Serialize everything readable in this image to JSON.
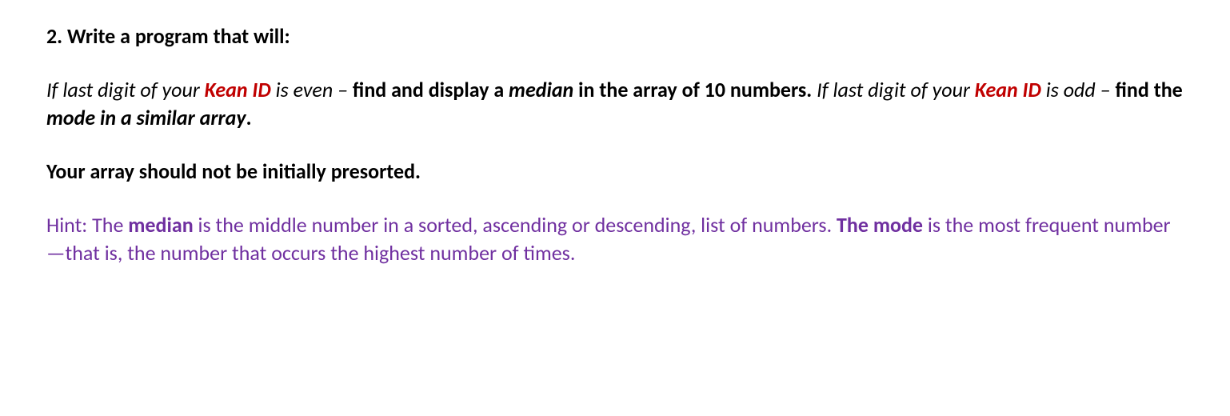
{
  "heading": "2. Write a program that will:",
  "p1": {
    "s1_pre": "If last digit of your ",
    "s1_kean": "Kean ID",
    "s1_mid": " is even – ",
    "s1_bold1": "find and display a ",
    "s1_median": "median",
    "s1_bold2": " in the array of 10 numbers. ",
    "s2_pre": "If last digit of your ",
    "s2_kean": "Kean ID",
    "s2_mid": " is odd – ",
    "s2_bold1": "find the ",
    "s2_mode": "mode in a similar array",
    "s2_bold2": "."
  },
  "p2": " Your array should not be initially presorted.",
  "hint": {
    "h_pre": "Hint: The ",
    "h_median": "median",
    "h_mid1": " is the middle number in a sorted, ascending or descending, list of numbers. ",
    "h_mode": "The mode",
    "h_mid2": " is the most frequent number—that is, the number that occurs the highest number of times."
  }
}
